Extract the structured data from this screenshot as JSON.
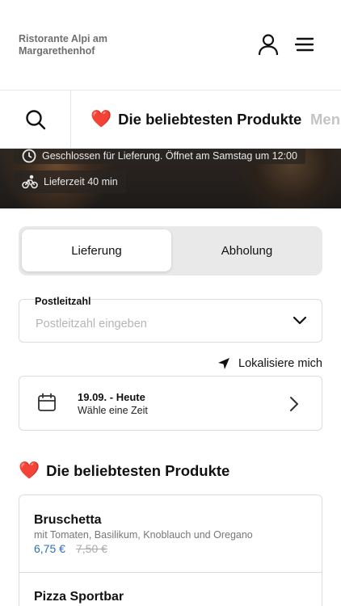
{
  "header": {
    "brand": "Ristorante Alpi am Margarethenhof",
    "icons": [
      "user-icon",
      "hamburger-menu-icon"
    ]
  },
  "categories": {
    "active": {
      "emoji": "❤️",
      "label": "Die beliebtesten Produkte"
    },
    "next": {
      "label": "Men"
    }
  },
  "hero": {
    "closed_notice": "Geschlossen für Lieferung. Öffnet am Samstag um 12:00",
    "delivery_time": "Lieferzeit 40 min"
  },
  "order_mode": {
    "delivery": "Lieferung",
    "pickup": "Abholung",
    "selected": "delivery"
  },
  "postal": {
    "label": "Postleitzahl",
    "placeholder": "Postleitzahl eingeben",
    "value": ""
  },
  "locate": {
    "label": "Lokalisiere mich"
  },
  "date": {
    "main": "19.09. - Heute",
    "sub": "Wähle eine Zeit"
  },
  "section": {
    "emoji": "❤️",
    "title": "Die beliebtesten Produkte"
  },
  "products": [
    {
      "name": "Bruschetta",
      "description": "mit Tomaten, Basilikum, Knoblauch und Oregano",
      "price": "6,75 €",
      "old_price": "7,50 €"
    },
    {
      "name": "Pizza Sportbar"
    }
  ],
  "colors": {
    "accent_price": "#2c6fb0",
    "heart": "#e0283a"
  }
}
